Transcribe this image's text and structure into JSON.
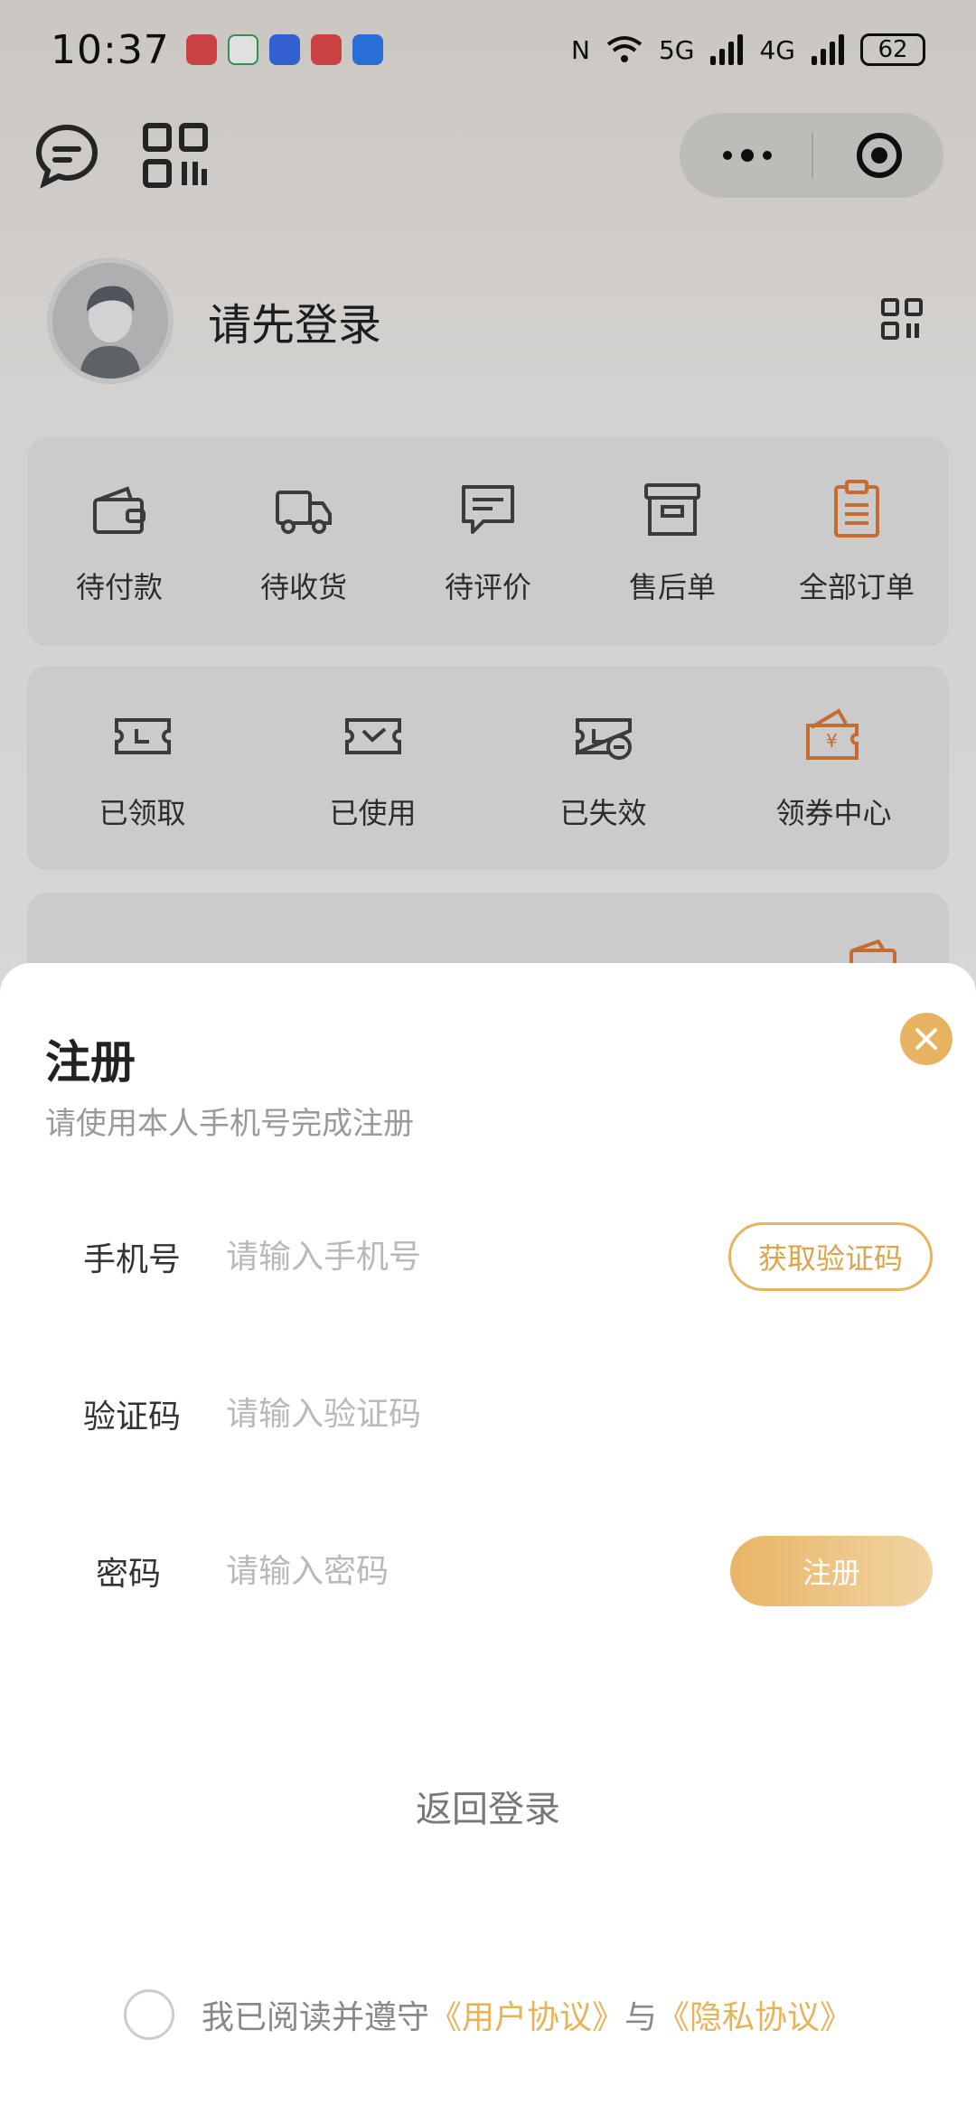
{
  "status_bar": {
    "time": "10:37",
    "battery": "62",
    "network_5g": "5G",
    "network_4g": "4G"
  },
  "profile": {
    "login_prompt": "请先登录"
  },
  "orders": {
    "items": [
      {
        "label": "待付款",
        "icon": "wallet-icon"
      },
      {
        "label": "待收货",
        "icon": "truck-icon"
      },
      {
        "label": "待评价",
        "icon": "comment-icon"
      },
      {
        "label": "售后单",
        "icon": "archive-icon"
      },
      {
        "label": "全部订单",
        "icon": "clipboard-icon"
      }
    ]
  },
  "coupons": {
    "items": [
      {
        "label": "已领取",
        "icon": "ticket-icon"
      },
      {
        "label": "已使用",
        "icon": "ticket-check-icon"
      },
      {
        "label": "已失效",
        "icon": "ticket-expired-icon"
      },
      {
        "label": "领券中心",
        "icon": "coupon-wallet-icon"
      }
    ]
  },
  "register": {
    "title": "注册",
    "subtitle": "请使用本人手机号完成注册",
    "phone_label": "手机号",
    "phone_placeholder": "请输入手机号",
    "get_code_label": "获取验证码",
    "code_label": "验证码",
    "code_placeholder": "请输入验证码",
    "password_label": "密码",
    "password_placeholder": "请输入密码",
    "submit_label": "注册",
    "back_login": "返回登录",
    "agree_prefix": "我已阅读并遵守",
    "user_agreement": "《用户协议》",
    "agree_and": "与",
    "privacy_agreement": "《隐私协议》"
  },
  "colors": {
    "accent": "#e8b360",
    "order_highlight": "#e07b3a"
  }
}
